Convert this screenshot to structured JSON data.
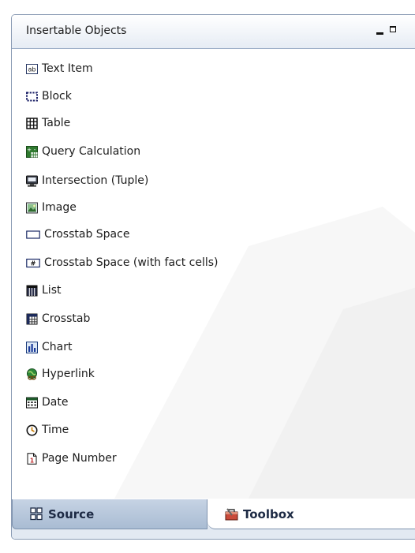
{
  "panel": {
    "title": "Insertable Objects"
  },
  "items": [
    {
      "label": "Text Item",
      "icon": "text-item-icon"
    },
    {
      "label": "Block",
      "icon": "block-icon"
    },
    {
      "label": "Table",
      "icon": "table-icon"
    },
    {
      "label": "Query Calculation",
      "icon": "query-calculation-icon"
    },
    {
      "label": "Intersection (Tuple)",
      "icon": "intersection-icon"
    },
    {
      "label": "Image",
      "icon": "image-icon"
    },
    {
      "label": "Crosstab Space",
      "icon": "crosstab-space-icon"
    },
    {
      "label": "Crosstab Space (with fact cells)",
      "icon": "crosstab-space-fact-icon"
    },
    {
      "label": "List",
      "icon": "list-icon"
    },
    {
      "label": "Crosstab",
      "icon": "crosstab-icon"
    },
    {
      "label": "Chart",
      "icon": "chart-icon"
    },
    {
      "label": "Hyperlink",
      "icon": "hyperlink-icon"
    },
    {
      "label": "Date",
      "icon": "date-icon"
    },
    {
      "label": "Time",
      "icon": "time-icon"
    },
    {
      "label": "Page Number",
      "icon": "page-number-icon"
    }
  ],
  "tabs": {
    "source": "Source",
    "toolbox": "Toolbox"
  },
  "colors": {
    "panel_border": "#8a9bb4",
    "tab_active_bg": "#a9bcd3",
    "tabbar_bg": "#e2e9f2"
  }
}
